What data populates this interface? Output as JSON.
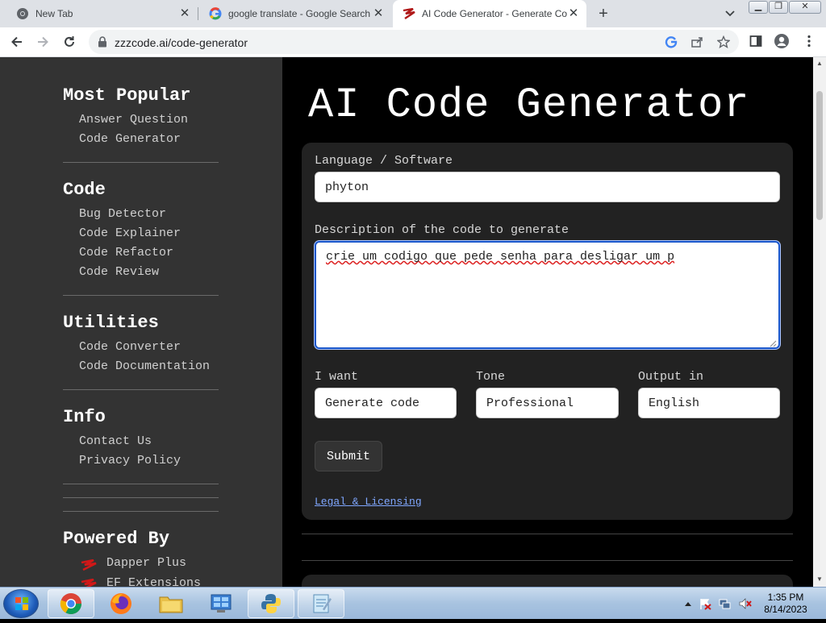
{
  "browser": {
    "tabs": [
      {
        "title": "New Tab"
      },
      {
        "title": "google translate - Google Search"
      },
      {
        "title": "AI Code Generator - Generate Co"
      }
    ],
    "url": "zzzcode.ai/code-generator"
  },
  "sidebar": {
    "sections": [
      {
        "heading": "Most Popular",
        "links": [
          "Answer Question",
          "Code Generator"
        ]
      },
      {
        "heading": "Code",
        "links": [
          "Bug Detector",
          "Code Explainer",
          "Code Refactor",
          "Code Review"
        ]
      },
      {
        "heading": "Utilities",
        "links": [
          "Code Converter",
          "Code Documentation"
        ]
      },
      {
        "heading": "Info",
        "links": [
          "Contact Us",
          "Privacy Policy"
        ]
      }
    ],
    "powered_by": {
      "heading": "Powered By",
      "links": [
        "Dapper Plus",
        "EF Extensions"
      ]
    }
  },
  "main": {
    "title": "AI Code Generator",
    "language_label": "Language / Software",
    "language_value": "phyton",
    "description_label": "Description of the code to generate",
    "description_value": "crie um codigo que pede senha para desligar um p",
    "i_want_label": "I want",
    "i_want_value": "Generate code",
    "tone_label": "Tone",
    "tone_value": "Professional",
    "output_label": "Output in",
    "output_value": "English",
    "submit_label": "Submit",
    "legal_label": "Legal & Licensing"
  },
  "taskbar": {
    "time": "1:35 PM",
    "date": "8/14/2023"
  },
  "colors": {
    "sidebar_bg": "#333333",
    "card_bg": "#222222",
    "focus_border": "#1a56c9",
    "link": "#7fa7ff"
  }
}
